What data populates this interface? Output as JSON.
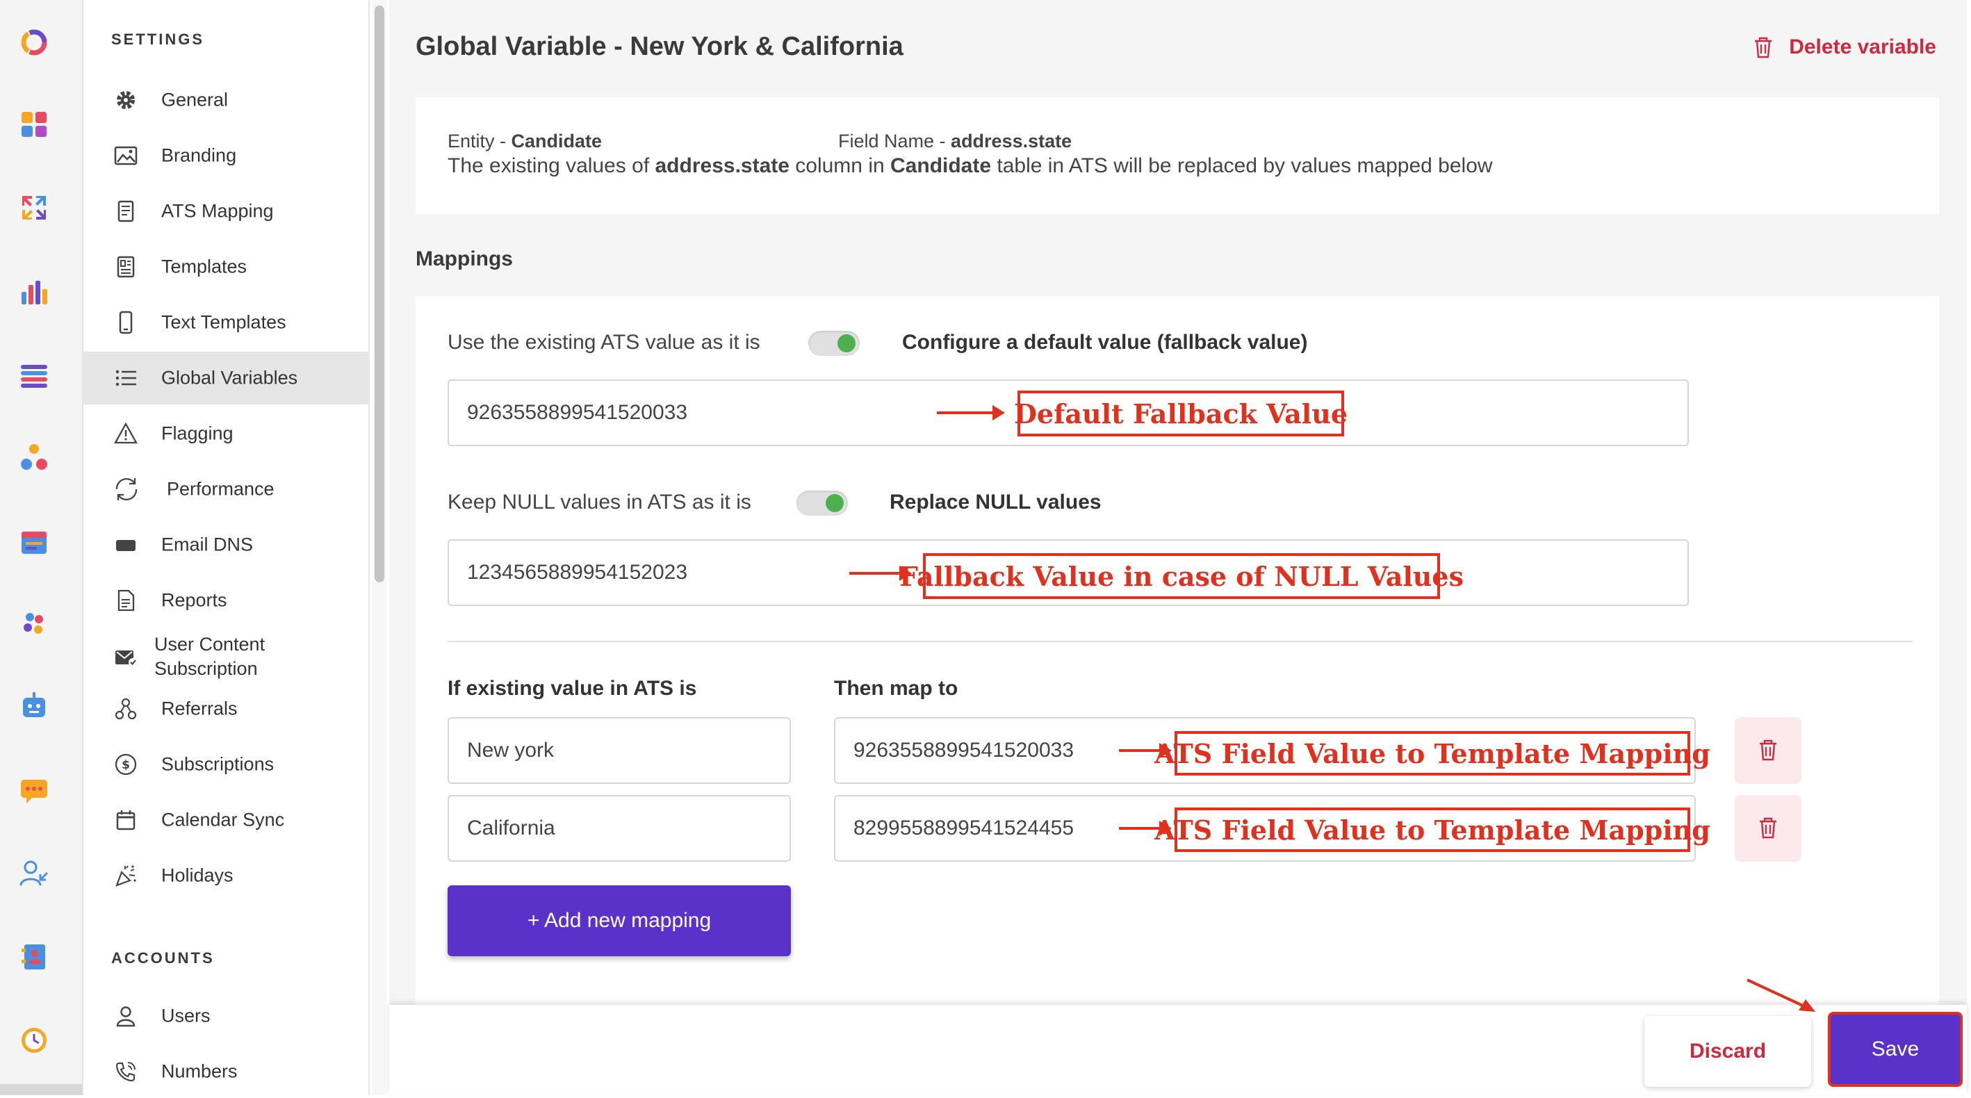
{
  "sidebar": {
    "settings_heading": "SETTINGS",
    "accounts_heading": "ACCOUNTS",
    "items": [
      {
        "label": "General",
        "icon": "gear-icon"
      },
      {
        "label": "Branding",
        "icon": "image-icon"
      },
      {
        "label": "ATS Mapping",
        "icon": "document-icon"
      },
      {
        "label": "Templates",
        "icon": "template-icon"
      },
      {
        "label": "Text Templates",
        "icon": "phone-icon"
      },
      {
        "label": "Global Variables",
        "icon": "list-icon"
      },
      {
        "label": "Flagging",
        "icon": "warning-icon"
      },
      {
        "label": "Performance",
        "icon": "refresh-icon"
      },
      {
        "label": "Email DNS",
        "icon": "email-icon"
      },
      {
        "label": "Reports",
        "icon": "report-icon"
      },
      {
        "label": "User Content Subscription",
        "icon": "mail-check-icon"
      },
      {
        "label": "Referrals",
        "icon": "referral-icon"
      },
      {
        "label": "Subscriptions",
        "icon": "dollar-icon"
      },
      {
        "label": "Calendar Sync",
        "icon": "calendar-icon"
      },
      {
        "label": "Holidays",
        "icon": "party-icon"
      }
    ],
    "account_items": [
      {
        "label": "Users",
        "icon": "user-icon"
      },
      {
        "label": "Numbers",
        "icon": "phone-call-icon"
      }
    ],
    "active_item": "Global Variables"
  },
  "header": {
    "title": "Global Variable - New York & California",
    "delete_label": "Delete variable"
  },
  "info": {
    "entity_label": "Entity - ",
    "entity_value": "Candidate",
    "field_label": "Field Name - ",
    "field_value": "address.state",
    "desc_1": "The existing values of ",
    "desc_field": "address.state",
    "desc_2": " column in ",
    "desc_entity": "Candidate",
    "desc_3": " table in ATS will be replaced by values mapped below"
  },
  "mappings": {
    "heading": "Mappings",
    "toggle1_left": "Use the existing ATS value as it is",
    "toggle1_right": "Configure a default value (fallback value)",
    "default_value": "9263558899541520033",
    "toggle2_left": "Keep NULL values in ATS as it is",
    "toggle2_right": "Replace NULL values",
    "null_value": "1234565889954152023",
    "col_existing": "If existing value in ATS is",
    "col_map": "Then map to",
    "rows": [
      {
        "existing": "New york",
        "mapped": "9263558899541520033"
      },
      {
        "existing": "California",
        "mapped": "8299558899541524455"
      }
    ],
    "add_label": "+ Add new mapping"
  },
  "annotations": {
    "default_fallback": "Default Fallback Value",
    "null_fallback": "Fallback Value in case of NULL Values",
    "row_mapping": "ATS Field Value to Template Mapping"
  },
  "footer": {
    "discard_label": "Discard",
    "save_label": "Save"
  },
  "colors": {
    "accent": "#5a31c9",
    "danger": "#d0283c",
    "toggle_on": "#4caf50",
    "annotation": "#e0301e"
  }
}
